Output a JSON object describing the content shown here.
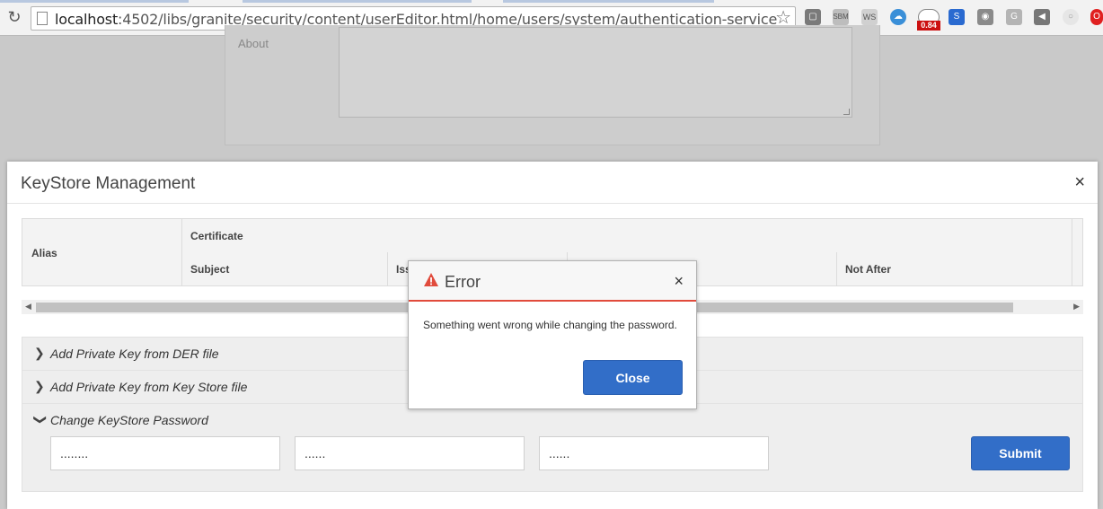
{
  "browser": {
    "url_host": "localhost",
    "url_rest": ":4502/libs/granite/security/content/userEditor.html/home/users/system/authentication-service",
    "badge_value": "0.84",
    "extension_icons": [
      "chromecast-icon",
      "sbm-icon",
      "ws-icon",
      "cloud-icon",
      "speedometer-icon",
      "s-icon",
      "camera-icon",
      "g-icon",
      "audio-icon",
      "circle-icon",
      "opera-icon"
    ]
  },
  "background_page": {
    "about_label": "About"
  },
  "keystore_modal": {
    "title": "KeyStore Management",
    "close_glyph": "×",
    "table": {
      "headers": {
        "alias": "Alias",
        "certificate": "Certificate",
        "subject": "Subject",
        "issuer": "Iss",
        "not_after": "Not After"
      }
    },
    "accordion": {
      "items": [
        {
          "label": "Add Private Key from DER file",
          "expanded": false
        },
        {
          "label": "Add Private Key from Key Store file",
          "expanded": false
        },
        {
          "label": "Change KeyStore Password",
          "expanded": true
        }
      ],
      "password_fields": [
        "........",
        "......",
        "......"
      ],
      "submit_label": "Submit"
    }
  },
  "error_dialog": {
    "title": "Error",
    "message": "Something went wrong while changing the password.",
    "close_label": "Close",
    "close_glyph": "×",
    "accent_color": "#e14b3c"
  },
  "colors": {
    "primary_button": "#326ec8"
  }
}
